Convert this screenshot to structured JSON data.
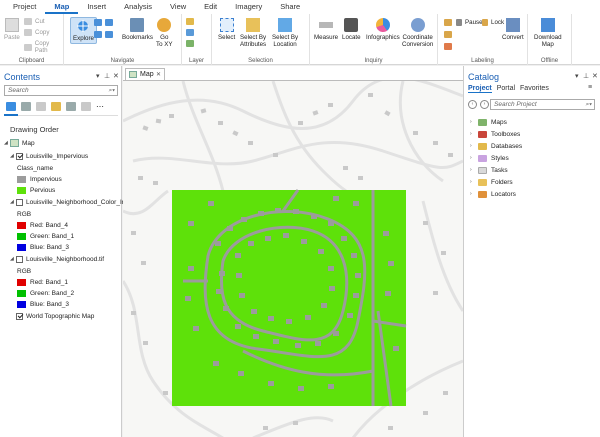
{
  "ribbon_tabs": [
    "Project",
    "Map",
    "Insert",
    "Analysis",
    "View",
    "Edit",
    "Imagery",
    "Share"
  ],
  "active_tab": "Map",
  "clipboard": {
    "paste": "Paste",
    "cut": "Cut",
    "copy": "Copy",
    "copy_path": "Copy Path",
    "label": "Clipboard"
  },
  "navigate": {
    "explore": "Explore",
    "bookmarks": "Bookmarks",
    "goto": "Go\nTo XY",
    "label": "Navigate"
  },
  "layer": {
    "label": "Layer"
  },
  "selection": {
    "select": "Select",
    "by_attr": "Select By\nAttributes",
    "by_loc": "Select By\nLocation",
    "label": "Selection"
  },
  "inquiry": {
    "measure": "Measure",
    "locate": "Locate",
    "infographics": "Infographics",
    "coord": "Coordinate\nConversion",
    "label": "Inquiry"
  },
  "labeling": {
    "pause": "Pause",
    "lock": "Lock",
    "label": "Labeling"
  },
  "convert": {
    "label": "Convert"
  },
  "offline": {
    "download": "Download\nMap",
    "label": "Offline"
  },
  "contents": {
    "title": "Contents",
    "search_placeholder": "Search",
    "drawing_order": "Drawing Order",
    "map_name": "Map",
    "layer1": "Louisville_Impervious",
    "class_name": "Class_name",
    "impervious": "Impervious",
    "pervious": "Pervious",
    "layer2": "Louisville_Neighborhood_Color_Inf",
    "rgb": "RGB",
    "l2_red": "Red:  Band_4",
    "l2_green": "Green: Band_1",
    "l2_blue": "Blue:  Band_3",
    "layer3": "Louisville_Neighborhood.tif",
    "l3_red": "Red:  Band_1",
    "l3_green": "Green: Band_2",
    "l3_blue": "Blue:  Band_3",
    "basemap": "World Topographic Map"
  },
  "map_tab": "Map",
  "catalog": {
    "title": "Catalog",
    "tabs": [
      "Project",
      "Portal",
      "Favorites"
    ],
    "search_placeholder": "Search Project",
    "items": [
      "Maps",
      "Toolboxes",
      "Databases",
      "Styles",
      "Tasks",
      "Folders",
      "Locators"
    ]
  },
  "colors": {
    "accent": "#1a73c8",
    "impervious": "#9c9c9c",
    "pervious": "#5ee10a",
    "red": "#e00000",
    "green": "#00c000",
    "blue": "#0000e0"
  }
}
